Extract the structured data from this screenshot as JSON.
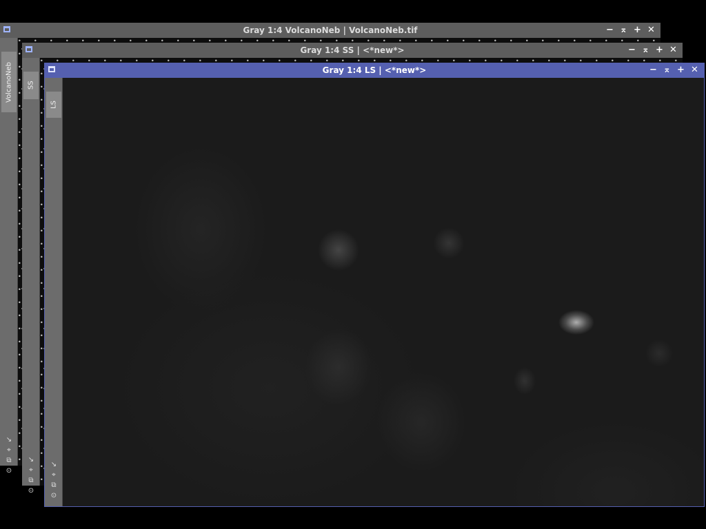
{
  "windows": [
    {
      "id": "volcanoneb",
      "title": "Gray 1:4 VolcanoNeb | VolcanoNeb.tif",
      "side_tab": "VolcanoNeb",
      "active": false
    },
    {
      "id": "ss",
      "title": "Gray 1:4 SS | <*new*>",
      "side_tab": "SS",
      "active": false
    },
    {
      "id": "ls",
      "title": "Gray 1:4 LS | <*new*>",
      "side_tab": "LS",
      "active": true
    }
  ],
  "controls": {
    "minimize": "−",
    "shade": "⌅",
    "maximize": "+",
    "close": "✕"
  },
  "side_icons": {
    "fit": "↘",
    "zoom_fit": "⌖",
    "clone": "⧉",
    "target": "⊙"
  },
  "colors": {
    "active_titlebar": "#5560b0",
    "inactive_titlebar": "#5d5d5d",
    "background": "#000000"
  }
}
